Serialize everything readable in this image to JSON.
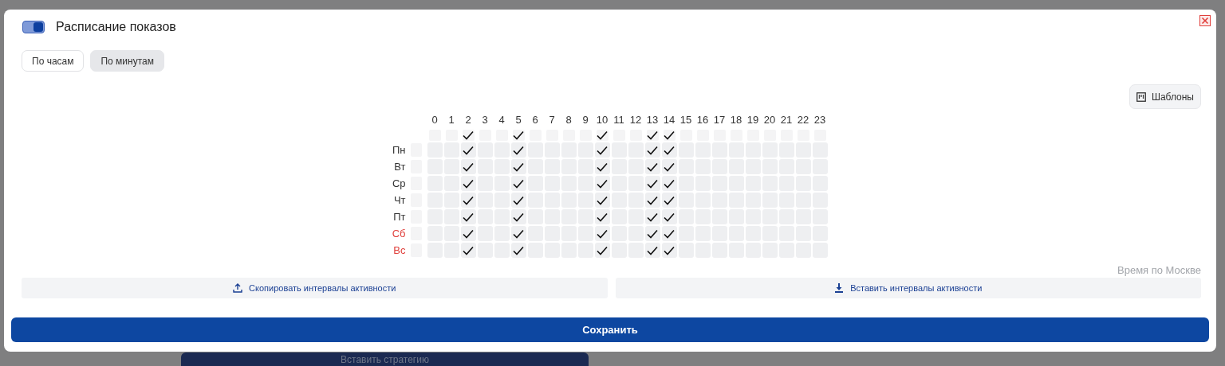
{
  "backdrop": {
    "behind_button": "Вставить стратегию"
  },
  "modal": {
    "title": "Расписание показов",
    "enabled": true
  },
  "tabs": [
    {
      "label": "По часам",
      "selected": false
    },
    {
      "label": "По минутам",
      "selected": true
    }
  ],
  "templates_button": "Шаблоны",
  "hours": [
    "0",
    "1",
    "2",
    "3",
    "4",
    "5",
    "6",
    "7",
    "8",
    "9",
    "10",
    "11",
    "12",
    "13",
    "14",
    "15",
    "16",
    "17",
    "18",
    "19",
    "20",
    "21",
    "22",
    "23"
  ],
  "column_toggles": [
    false,
    false,
    true,
    false,
    false,
    true,
    false,
    false,
    false,
    false,
    true,
    false,
    false,
    true,
    true,
    false,
    false,
    false,
    false,
    false,
    false,
    false,
    false,
    false
  ],
  "days": [
    {
      "label": "Пн",
      "weekend": false,
      "row_toggle": false,
      "cells": [
        false,
        false,
        true,
        false,
        false,
        true,
        false,
        false,
        false,
        false,
        true,
        false,
        false,
        true,
        true,
        false,
        false,
        false,
        false,
        false,
        false,
        false,
        false,
        false
      ]
    },
    {
      "label": "Вт",
      "weekend": false,
      "row_toggle": false,
      "cells": [
        false,
        false,
        true,
        false,
        false,
        true,
        false,
        false,
        false,
        false,
        true,
        false,
        false,
        true,
        true,
        false,
        false,
        false,
        false,
        false,
        false,
        false,
        false,
        false
      ]
    },
    {
      "label": "Ср",
      "weekend": false,
      "row_toggle": false,
      "cells": [
        false,
        false,
        true,
        false,
        false,
        true,
        false,
        false,
        false,
        false,
        true,
        false,
        false,
        true,
        true,
        false,
        false,
        false,
        false,
        false,
        false,
        false,
        false,
        false
      ]
    },
    {
      "label": "Чт",
      "weekend": false,
      "row_toggle": false,
      "cells": [
        false,
        false,
        true,
        false,
        false,
        true,
        false,
        false,
        false,
        false,
        true,
        false,
        false,
        true,
        true,
        false,
        false,
        false,
        false,
        false,
        false,
        false,
        false,
        false
      ]
    },
    {
      "label": "Пт",
      "weekend": false,
      "row_toggle": false,
      "cells": [
        false,
        false,
        true,
        false,
        false,
        true,
        false,
        false,
        false,
        false,
        true,
        false,
        false,
        true,
        true,
        false,
        false,
        false,
        false,
        false,
        false,
        false,
        false,
        false
      ]
    },
    {
      "label": "Сб",
      "weekend": true,
      "row_toggle": false,
      "cells": [
        false,
        false,
        true,
        false,
        false,
        true,
        false,
        false,
        false,
        false,
        true,
        false,
        false,
        true,
        true,
        false,
        false,
        false,
        false,
        false,
        false,
        false,
        false,
        false
      ]
    },
    {
      "label": "Вс",
      "weekend": true,
      "row_toggle": false,
      "cells": [
        false,
        false,
        true,
        false,
        false,
        true,
        false,
        false,
        false,
        false,
        true,
        false,
        false,
        true,
        true,
        false,
        false,
        false,
        false,
        false,
        false,
        false,
        false,
        false
      ]
    }
  ],
  "timezone_note": "Время по Москве",
  "copy_button": "Скопировать интервалы активности",
  "paste_button": "Вставить интервалы активности",
  "save_button": "Сохранить"
}
